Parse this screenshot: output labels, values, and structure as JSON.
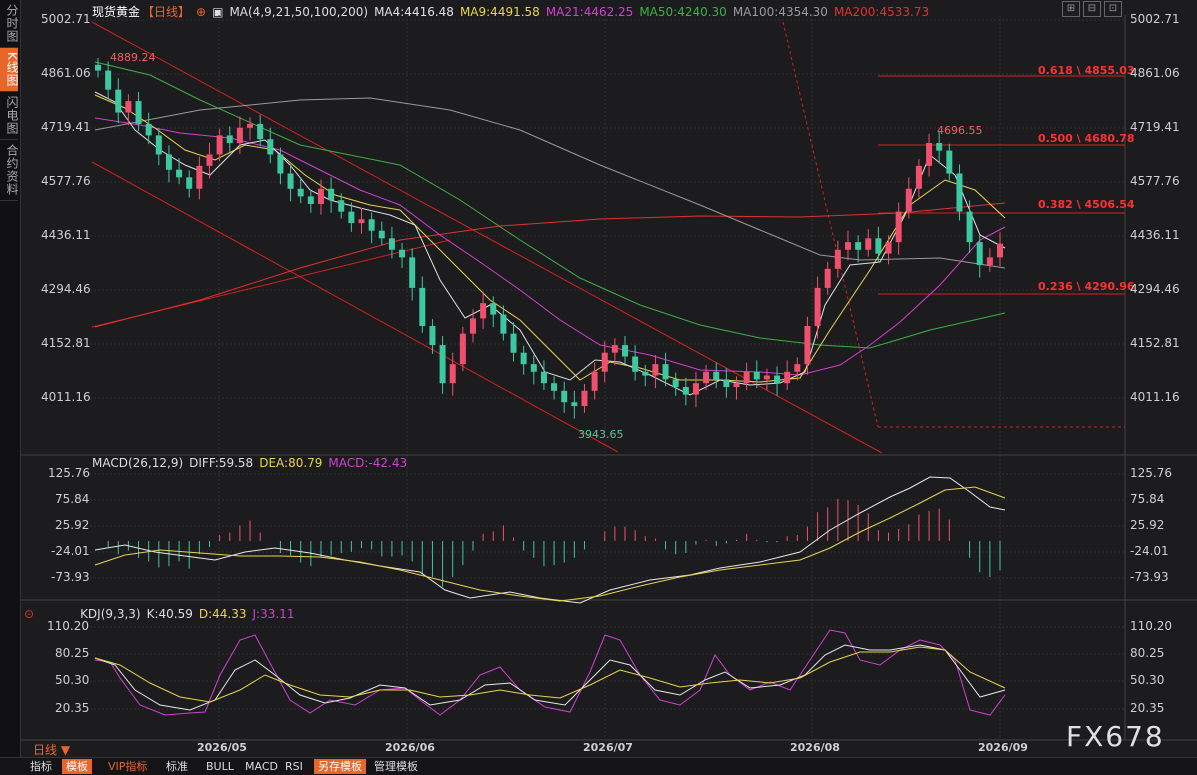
{
  "sidebar": {
    "tabs": [
      {
        "label": "分时图",
        "active": false
      },
      {
        "label": "K线图",
        "active": true
      },
      {
        "label": "闪电图",
        "active": false
      },
      {
        "label": "合约资料",
        "active": false
      }
    ]
  },
  "header": {
    "title": "现货黄金",
    "period": "【日线】",
    "ma_label": "MA(4,9,21,50,100,200)",
    "ma": [
      {
        "text": "MA4:4416.48",
        "color": "#e0e0e0"
      },
      {
        "text": "MA9:4491.58",
        "color": "#e8d44d"
      },
      {
        "text": "MA21:4462.25",
        "color": "#d040d0"
      },
      {
        "text": "MA50:4240.30",
        "color": "#3cb043"
      },
      {
        "text": "MA100:4354.30",
        "color": "#9a9a9a"
      },
      {
        "text": "MA200:4533.73",
        "color": "#e03030"
      }
    ],
    "toolbar_icons": [
      "zoom-in-icon",
      "zoom-out-icon",
      "fullscreen-icon",
      "close-icon"
    ]
  },
  "price_axis": [
    "5002.71",
    "4861.06",
    "4719.41",
    "4577.76",
    "4436.11",
    "4294.46",
    "4152.81",
    "4011.16"
  ],
  "annotations": {
    "high": "4889.24",
    "low": "3943.65",
    "recent_high": "4696.55"
  },
  "fibonacci": [
    {
      "label": "0.618 \\ 4855.03",
      "price": 4855.03
    },
    {
      "label": "0.500 \\ 4680.78",
      "price": 4680.78
    },
    {
      "label": "0.382 \\ 4506.54",
      "price": 4506.54
    },
    {
      "label": "0.236 \\ 4290.96",
      "price": 4290.96
    }
  ],
  "macd": {
    "label": "MACD(26,12,9)",
    "diff": "DIFF:59.58",
    "dea": "DEA:80.79",
    "macd": "MACD:-42.43",
    "axis": [
      "125.76",
      "75.84",
      "25.92",
      "-24.01",
      "-73.93"
    ]
  },
  "kdj": {
    "label": "KDJ(9,3,3)",
    "k": "K:40.59",
    "d": "D:44.33",
    "j": "J:33.11",
    "axis": [
      "110.20",
      "80.25",
      "50.30",
      "20.35"
    ]
  },
  "dates": [
    "2026/05",
    "2026/06",
    "2026/07",
    "2026/08",
    "2026/09"
  ],
  "period_selector": "日线 ▼",
  "bottom_buttons": [
    {
      "label": "指标",
      "highlight": false
    },
    {
      "label": "模板",
      "highlight": true
    },
    {
      "label": "VIP指标",
      "highlight": false
    },
    {
      "label": "标准",
      "highlight": false
    },
    {
      "label": "BULL",
      "highlight": false
    },
    {
      "label": "MACD",
      "highlight": false
    },
    {
      "label": "RSI",
      "highlight": false
    },
    {
      "label": "另存模板",
      "highlight": true
    },
    {
      "label": "管理模板",
      "highlight": false
    }
  ],
  "watermark": "FX678",
  "chart_data": {
    "type": "candlestick",
    "x": [
      "2026/05",
      "2026/06",
      "2026/07",
      "2026/08",
      "2026/09"
    ],
    "price_range": [
      3943.65,
      5002.71
    ],
    "close": [
      4870,
      4820,
      4760,
      4790,
      4730,
      4700,
      4650,
      4610,
      4590,
      4560,
      4620,
      4650,
      4700,
      4680,
      4720,
      4730,
      4690,
      4650,
      4600,
      4560,
      4540,
      4520,
      4560,
      4530,
      4500,
      4470,
      4480,
      4450,
      4430,
      4400,
      4380,
      4300,
      4200,
      4150,
      4050,
      4100,
      4180,
      4220,
      4260,
      4230,
      4180,
      4130,
      4100,
      4080,
      4050,
      4030,
      4000,
      3990,
      4030,
      4080,
      4130,
      4150,
      4120,
      4080,
      4070,
      4100,
      4060,
      4040,
      4020,
      4050,
      4080,
      4060,
      4040,
      4050,
      4080,
      4060,
      4070,
      4050,
      4080,
      4100,
      4200,
      4300,
      4350,
      4400,
      4420,
      4400,
      4430,
      4390,
      4420,
      4500,
      4560,
      4620,
      4680,
      4660,
      4600,
      4500,
      4420,
      4360,
      4380,
      4416
    ]
  }
}
